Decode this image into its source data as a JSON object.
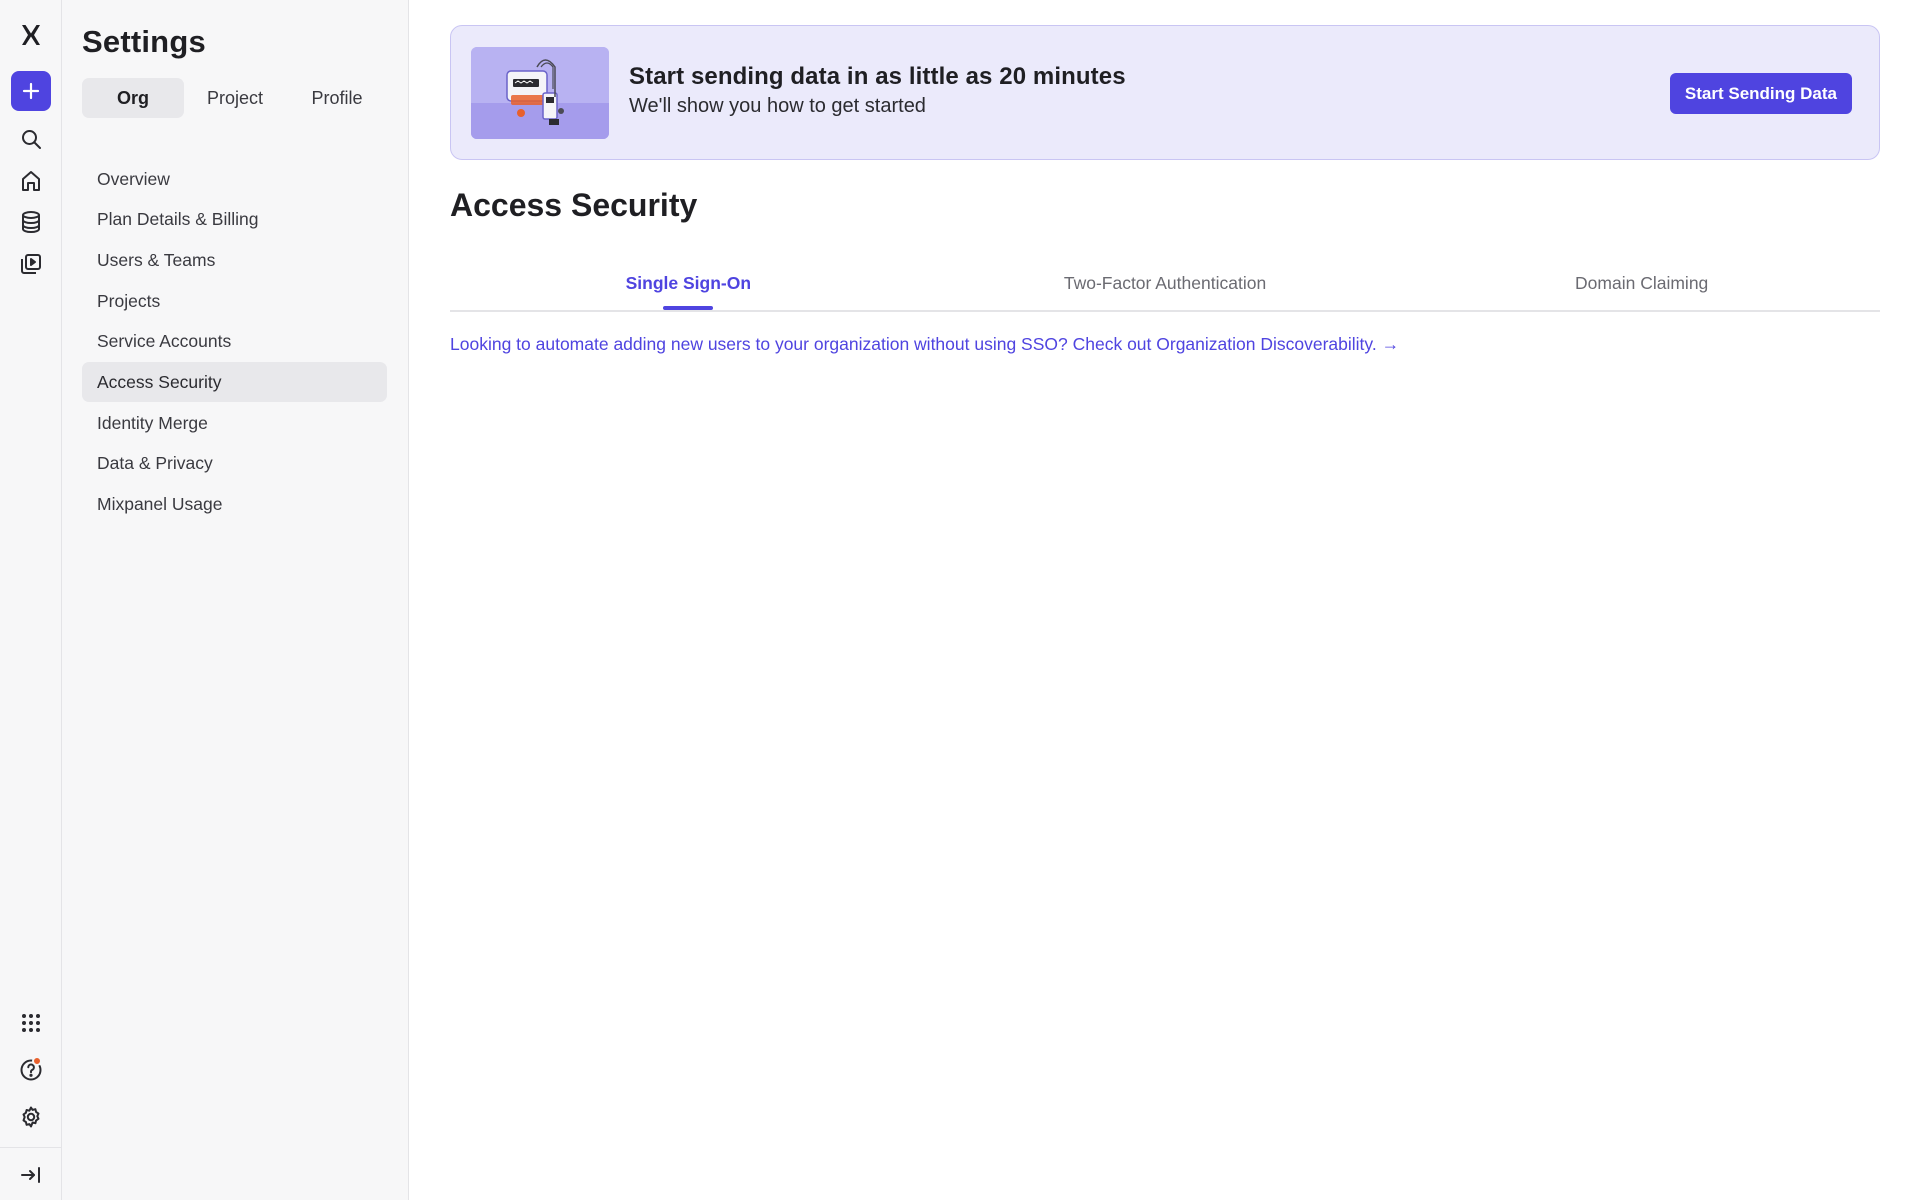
{
  "rail": {
    "icons": [
      "mixpanel-logo",
      "plus-icon",
      "search-icon",
      "home-icon",
      "database-icon",
      "boards-icon",
      "apps-grid-icon",
      "help-icon",
      "gear-icon",
      "collapse-icon"
    ]
  },
  "sidebar": {
    "title": "Settings",
    "scope_tabs": [
      {
        "label": "Org",
        "active": true
      },
      {
        "label": "Project",
        "active": false
      },
      {
        "label": "Profile",
        "active": false
      }
    ],
    "items": [
      {
        "label": "Overview"
      },
      {
        "label": "Plan Details & Billing"
      },
      {
        "label": "Users & Teams"
      },
      {
        "label": "Projects"
      },
      {
        "label": "Service Accounts"
      },
      {
        "label": "Access Security",
        "active": true
      },
      {
        "label": "Identity Merge"
      },
      {
        "label": "Data & Privacy"
      },
      {
        "label": "Mixpanel Usage"
      }
    ]
  },
  "banner": {
    "title": "Start sending data in as little as 20 minutes",
    "subtitle": "We'll show you how to get started",
    "button": "Start Sending Data"
  },
  "main": {
    "title": "Access Security",
    "tabs": [
      {
        "label": "Single Sign-On",
        "active": true
      },
      {
        "label": "Two-Factor Authentication",
        "active": false
      },
      {
        "label": "Domain Claiming",
        "active": false
      }
    ],
    "info_link": "Looking to automate adding new users to your organization without using SSO? Check out Organization Discoverability. →"
  },
  "colors": {
    "accent": "#4f44e0",
    "banner_bg": "#ebeafb",
    "sidebar_bg": "#f7f7f8",
    "notification": "#e8602c"
  }
}
